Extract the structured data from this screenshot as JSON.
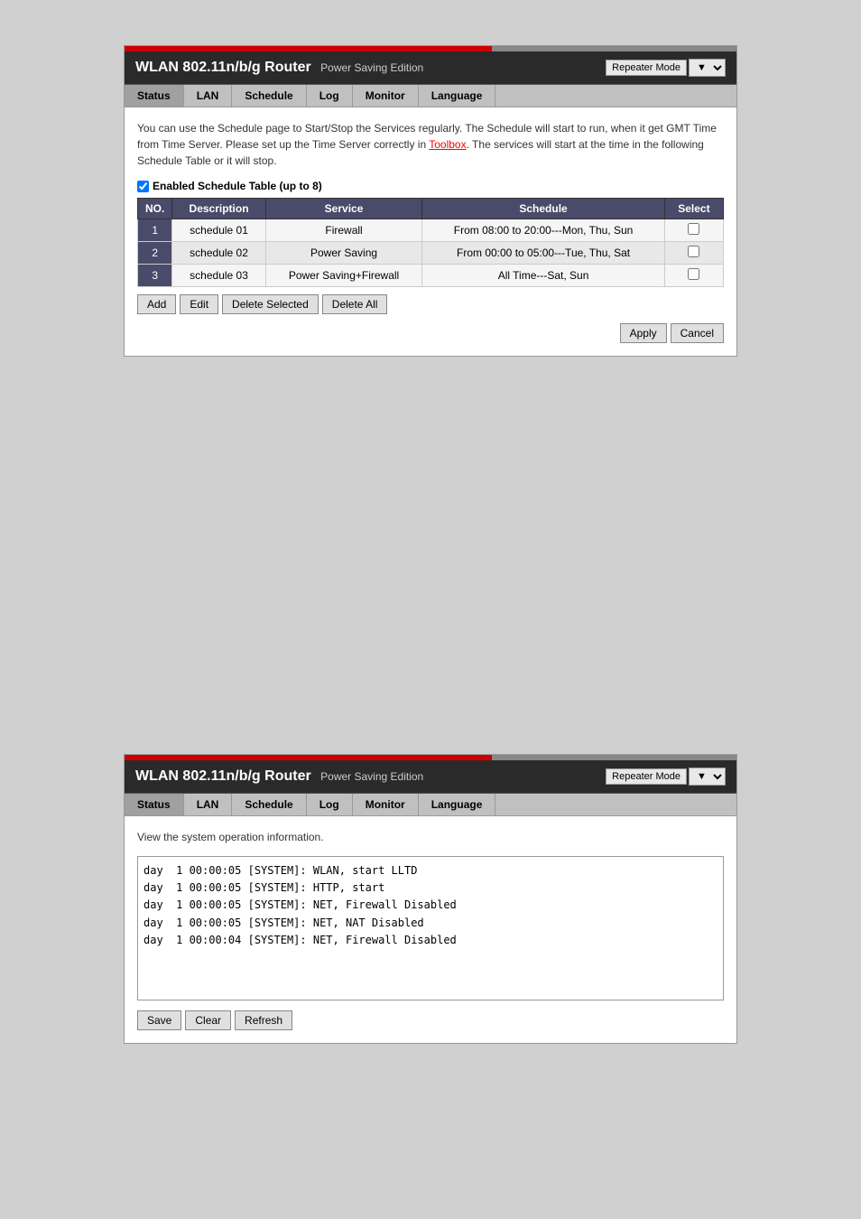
{
  "panel1": {
    "title_bold": "WLAN 802.11n/b/g Router",
    "title_sub": "Power Saving Edition",
    "repeater_mode_label": "Repeater Mode",
    "nav": [
      {
        "label": "Status",
        "active": false
      },
      {
        "label": "LAN",
        "active": false
      },
      {
        "label": "Schedule",
        "active": true
      },
      {
        "label": "Log",
        "active": false
      },
      {
        "label": "Monitor",
        "active": false
      },
      {
        "label": "Language",
        "active": false
      }
    ],
    "description": "You can use the Schedule page to Start/Stop the Services regularly. The Schedule will start to run, when it get GMT Time from Time Server. Please set up the Time Server correctly in Toolbox. The services will start at the time in the following Schedule Table or it will stop.",
    "description_link": "Toolbox",
    "enabled_label": "Enabled Schedule Table (up to 8)",
    "table": {
      "headers": [
        "NO.",
        "Description",
        "Service",
        "Schedule",
        "Select"
      ],
      "rows": [
        {
          "no": "1",
          "description": "schedule 01",
          "service": "Firewall",
          "schedule": "From 08:00 to 20:00---Mon, Thu, Sun"
        },
        {
          "no": "2",
          "description": "schedule 02",
          "service": "Power Saving",
          "schedule": "From 00:00 to 05:00---Tue, Thu, Sat"
        },
        {
          "no": "3",
          "description": "schedule 03",
          "service": "Power Saving+Firewall",
          "schedule": "All Time---Sat, Sun"
        }
      ]
    },
    "buttons": {
      "add": "Add",
      "edit": "Edit",
      "delete_selected": "Delete Selected",
      "delete_all": "Delete All",
      "apply": "Apply",
      "cancel": "Cancel"
    }
  },
  "panel2": {
    "title_bold": "WLAN 802.11n/b/g Router",
    "title_sub": "Power Saving Edition",
    "repeater_mode_label": "Repeater Mode",
    "nav": [
      {
        "label": "Status",
        "active": false
      },
      {
        "label": "LAN",
        "active": false
      },
      {
        "label": "Schedule",
        "active": false
      },
      {
        "label": "Log",
        "active": true
      },
      {
        "label": "Monitor",
        "active": false
      },
      {
        "label": "Language",
        "active": false
      }
    ],
    "view_text": "View the system operation information.",
    "log_lines": [
      "day  1 00:00:05 [SYSTEM]: WLAN, start LLTD",
      "day  1 00:00:05 [SYSTEM]: HTTP, start",
      "day  1 00:00:05 [SYSTEM]: NET, Firewall Disabled",
      "day  1 00:00:05 [SYSTEM]: NET, NAT Disabled",
      "day  1 00:00:04 [SYSTEM]: NET, Firewall Disabled"
    ],
    "buttons": {
      "save": "Save",
      "clear": "Clear",
      "refresh": "Refresh"
    }
  }
}
